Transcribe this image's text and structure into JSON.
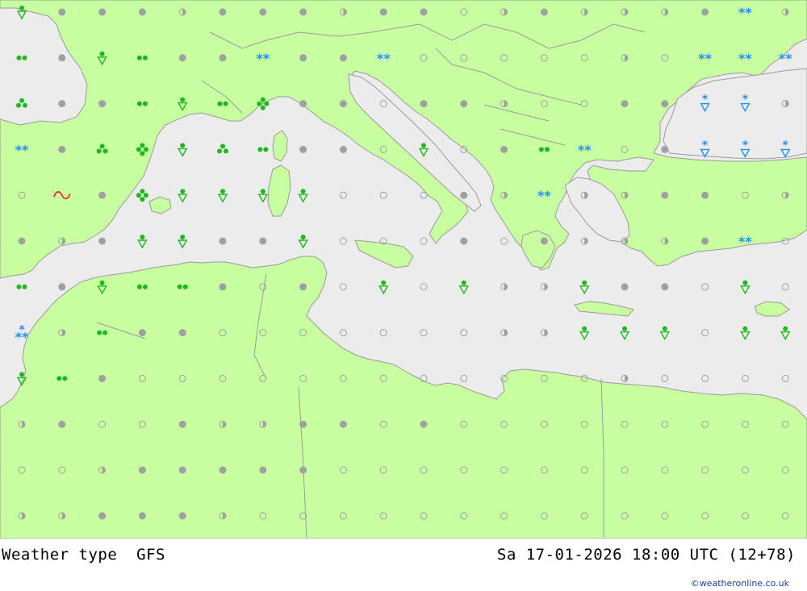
{
  "map": {
    "colors": {
      "sea": "#ececec",
      "land": "#c8ffa0",
      "border": "#9a9a9a",
      "dot": "#a0a0a0",
      "rain": "#1db81d",
      "snow": "#1e90ff",
      "fog": "#e8200e"
    },
    "grid": {
      "rows": [
        [
          "rainshower",
          "dot",
          "dot",
          "dot",
          "half",
          "dot",
          "dot",
          "dot",
          "half",
          "dot",
          "dot",
          "circle",
          "half",
          "dot",
          "half",
          "half",
          "half",
          "dot",
          "snow",
          "half"
        ],
        [
          "drizzle",
          "dot",
          "rainshower",
          "drizzle",
          "dot",
          "dot",
          "snow",
          "dot",
          "dot",
          "snow",
          "circle",
          "circle",
          "circle",
          "circle",
          "circle",
          "half",
          "circle",
          "snow",
          "snow",
          "snow"
        ],
        [
          "rain",
          "dot",
          "dot",
          "drizzle",
          "rainshower",
          "drizzle",
          "heavyrain",
          "dot",
          "dot",
          "circle",
          "dot",
          "dot",
          "half",
          "circle",
          "circle",
          "dot",
          "dot",
          "snowshower",
          "snowshower",
          "half"
        ],
        [
          "snow",
          "dot",
          "rain",
          "heavyrain",
          "rainshower",
          "rain",
          "drizzle",
          "dot",
          "dot",
          "circle",
          "rainshower",
          "circle",
          "dot",
          "drizzle",
          "snow",
          "circle",
          "dot",
          "snowshower",
          "snowshower",
          "snowshower"
        ],
        [
          "circle",
          "fog",
          "dot",
          "heavyrain",
          "rainshower",
          "rainshower",
          "rainshower",
          "rainshower",
          "circle",
          "circle",
          "circle",
          "dot",
          "half",
          "snow",
          "half",
          "half",
          "dot",
          "dot",
          "circle",
          "half"
        ],
        [
          "dot",
          "half",
          "dot",
          "rainshower",
          "rainshower",
          "dot",
          "dot",
          "rainshower",
          "circle",
          "circle",
          "circle",
          "dot",
          "circle",
          "dot",
          "half",
          "half",
          "half",
          "dot",
          "snow",
          "circle"
        ],
        [
          "drizzle",
          "dot",
          "rainshower",
          "drizzle",
          "drizzle",
          "dot",
          "circle",
          "dot",
          "circle",
          "rainshower",
          "circle",
          "rainshower",
          "half",
          "half",
          "rainshower",
          "dot",
          "dot",
          "circle",
          "rainshower",
          "circle"
        ],
        [
          "snowmix",
          "half",
          "drizzle",
          "dot",
          "dot",
          "circle",
          "circle",
          "circle",
          "circle",
          "circle",
          "circle",
          "circle",
          "half",
          "half",
          "rainshower",
          "rainshower",
          "rainshower",
          "circle",
          "rainshower",
          "rainshower"
        ],
        [
          "rainshower",
          "drizzle",
          "dot",
          "circle",
          "circle",
          "circle",
          "circle",
          "circle",
          "circle",
          "circle",
          "circle",
          "circle",
          "circle",
          "circle",
          "circle",
          "half",
          "circle",
          "circle",
          "circle",
          "circle"
        ],
        [
          "half",
          "dot",
          "circle",
          "circle",
          "dot",
          "half",
          "half",
          "dot",
          "dot",
          "circle",
          "dot",
          "circle",
          "circle",
          "circle",
          "circle",
          "circle",
          "circle",
          "circle",
          "circle",
          "circle"
        ],
        [
          "circle",
          "circle",
          "half",
          "dot",
          "dot",
          "dot",
          "dot",
          "dot",
          "circle",
          "circle",
          "circle",
          "circle",
          "circle",
          "circle",
          "circle",
          "circle",
          "circle",
          "circle",
          "circle",
          "circle"
        ],
        [
          "half",
          "half",
          "dot",
          "dot",
          "dot",
          "half",
          "circle",
          "circle",
          "circle",
          "circle",
          "circle",
          "circle",
          "circle",
          "circle",
          "circle",
          "circle",
          "circle",
          "circle",
          "circle",
          "circle"
        ]
      ]
    }
  },
  "footer": {
    "left": "Weather type  GFS",
    "right": "Sa 17-01-2026 18:00 UTC (12+78)",
    "credit": "©weatheronline.co.uk"
  }
}
